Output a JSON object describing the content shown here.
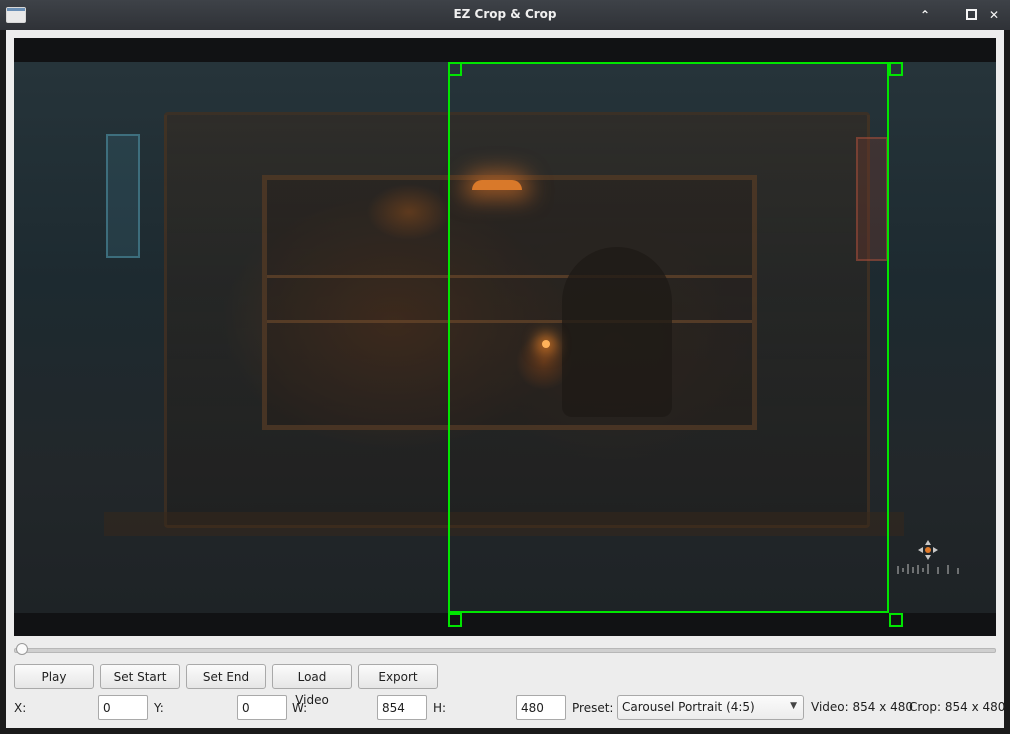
{
  "window": {
    "title": "EZ Crop & Crop",
    "controls": {
      "minimize": "⌃",
      "maximize": "□",
      "close": "✕"
    }
  },
  "video": {
    "watermark_icon": "move-icon",
    "accent_color": "#00e600"
  },
  "timeline": {
    "position": 0
  },
  "buttons": {
    "play": "Play",
    "set_start": "Set Start",
    "set_end": "Set End",
    "load_video": "Load Video",
    "export_crop": "Export Crop"
  },
  "fields": {
    "x": {
      "label": "X:",
      "value": "0"
    },
    "y": {
      "label": "Y:",
      "value": "0"
    },
    "w": {
      "label": "W:",
      "value": "854"
    },
    "h": {
      "label": "H:",
      "value": "480"
    }
  },
  "preset": {
    "label": "Preset:",
    "selected": "Carousel Portrait (4:5)"
  },
  "status": {
    "video": "Video: 854 x 480",
    "crop": "Crop: 854 x 480"
  }
}
